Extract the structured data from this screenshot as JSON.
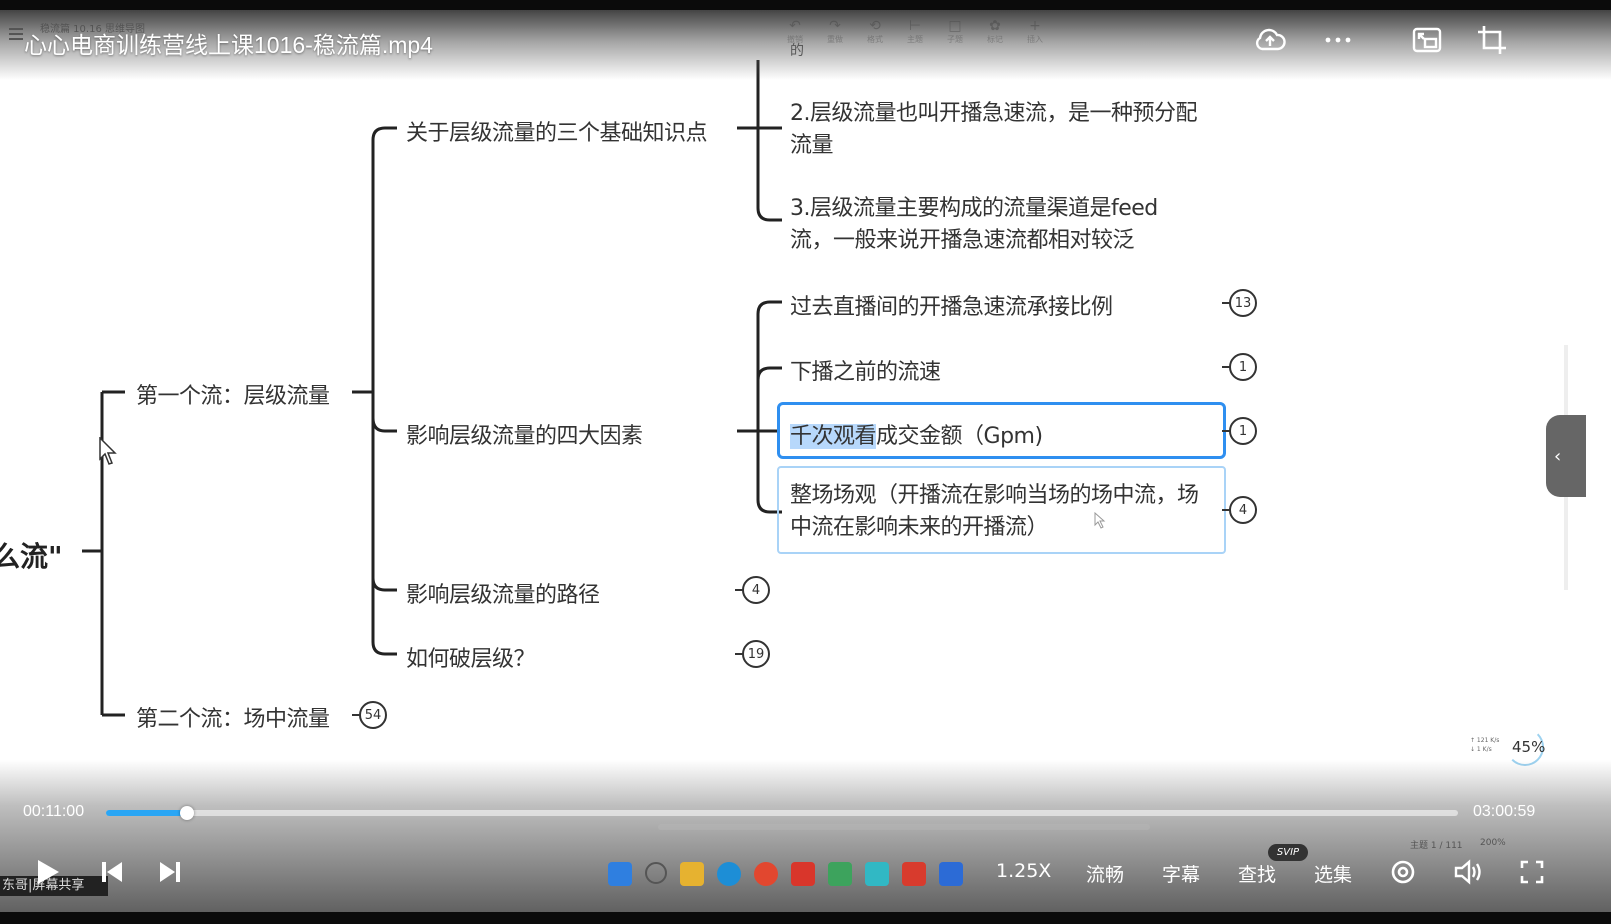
{
  "player": {
    "title": "心心电商训练营线上课1016-稳流篇.mp4",
    "current_time": "00:11:00",
    "total_time": "03:00:59",
    "progress": 0.06,
    "speed_label": "1.25X",
    "quality_label": "流畅",
    "subtitle_label": "字幕",
    "search_label": "查找",
    "episodes_label": "选集",
    "svip_badge": "SVIP",
    "icons": {
      "cloud": "cloud-upload-icon",
      "more": "more-dots-icon",
      "pip": "picture-in-picture-icon",
      "crop": "crop-icon",
      "play": "play-icon",
      "prev": "previous-icon",
      "next": "next-icon",
      "settings": "settings-icon",
      "volume": "volume-icon",
      "fullscreen": "fullscreen-icon"
    }
  },
  "recorded_screen": {
    "share_label": "东哥|屏幕共享",
    "speed_percent": "45%",
    "zoom_status": "200%",
    "page_status": "主题 1 / 111"
  },
  "mindmap": {
    "root": "么流\"",
    "branch1": "第一个流：层级流量",
    "branch2": "第二个流：场中流量",
    "branch2_badge": "54",
    "sub1": "关于层级流量的三个基础知识点",
    "sub1_item0": "的",
    "sub1_item2": "2.层级流量也叫开播急速流，是一种预分配流量",
    "sub1_item3": "3.层级流量主要构成的流量渠道是feed流，一般来说开播急速流都相对较泛",
    "sub2": "影响层级流量的四大因素",
    "factor1": "过去直播间的开播急速流承接比例",
    "factor1_badge": "13",
    "factor2": "下播之前的流速",
    "factor2_badge": "1",
    "factor3_hl": "千次观看",
    "factor3_rest": "成交金额（Gpm)",
    "factor3_badge": "1",
    "factor4": "整场场观（开播流在影响当场的场中流，场中流在影响未来的开播流）",
    "factor4_badge": "4",
    "sub3": "影响层级流量的路径",
    "sub3_badge": "4",
    "sub4": "如何破层级？",
    "sub4_badge": "19"
  }
}
